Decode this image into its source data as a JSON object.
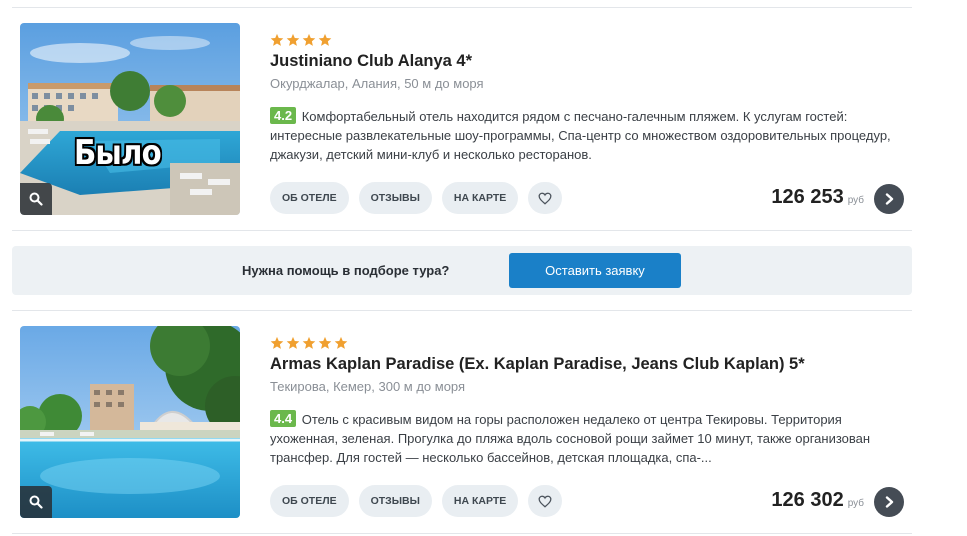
{
  "hotels": [
    {
      "stars": 4,
      "name": "Justiniano Club Alanya 4*",
      "location": "Окурджалар, Алания, 50 м до моря",
      "rating": "4.2",
      "description": "Комфортабельный отель находится рядом с песчано-галечным пляжем. К услугам гостей: интересные развлекательные шоу-программы, Спа-центр со множеством оздоровительных процедур, джакузи, детский мини-клуб и несколько ресторанов.",
      "overlay_text": "Было",
      "price": "126 253",
      "currency": "руб"
    },
    {
      "stars": 5,
      "name": "Armas Kaplan Paradise (Ex. Kaplan Paradise, Jeans Club Kaplan) 5*",
      "location": "Текирова, Кемер, 300 м до моря",
      "rating": "4.4",
      "description": "Отель с красивым видом на горы расположен недалеко от центра Текировы. Территория ухоженная, зеленая. Прогулка до пляжа вдоль сосновой рощи займет 10 минут, также организован трансфер. Для гостей — несколько бассейнов, детская площадка, спа-...",
      "price": "126 302",
      "currency": "руб"
    }
  ],
  "actions": {
    "about": "ОБ ОТЕЛЕ",
    "reviews": "ОТЗЫВЫ",
    "map": "НА КАРТЕ"
  },
  "help": {
    "text": "Нужна помощь в подборе тура?",
    "button": "Оставить заявку"
  },
  "colors": {
    "star": "#f0a030",
    "rating_bg": "#6bb84c",
    "cta": "#1a80c8",
    "pill_bg": "#e9eef2",
    "go_btn": "#454c55"
  },
  "icons": [
    "search-icon",
    "star-icon",
    "heart-icon",
    "chevron-right-icon"
  ]
}
